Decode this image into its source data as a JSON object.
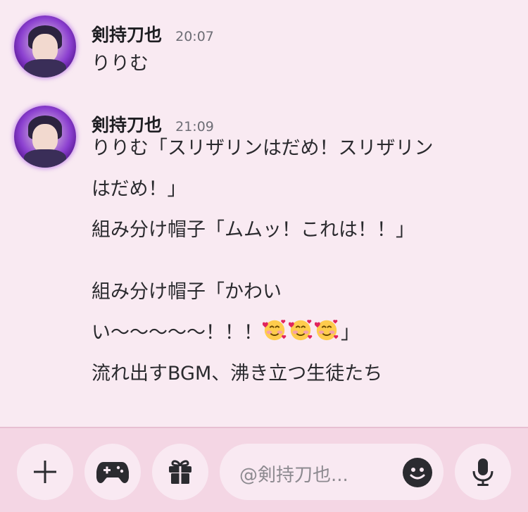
{
  "messages": [
    {
      "author": "剣持刀也",
      "time": "20:07",
      "lines": [
        "りりむ"
      ]
    },
    {
      "author": "剣持刀也",
      "time": "21:09",
      "lines": [
        "りりむ「スリザリンはだめ！スリザリン",
        "はだめ！」",
        "組み分け帽子「ムムッ！これは！！」",
        "",
        "組み分け帽子「かわい",
        "い〜〜〜〜〜！！！",
        "流れ出すBGM、沸き立つ生徒たち"
      ],
      "emoji_line_suffix": "」",
      "emoji_icon": "smiling-face-with-hearts-icon"
    }
  ],
  "composer": {
    "placeholder": "@剣持刀也...",
    "buttons": [
      "plus-icon",
      "gamepad-icon",
      "gift-icon",
      "emoji-icon",
      "microphone-icon"
    ]
  },
  "colors": {
    "background": "#f9eaf2",
    "composer_bar": "#f4d6e4",
    "button_fill": "#f9e9f2",
    "icon": "#2b2b30"
  }
}
